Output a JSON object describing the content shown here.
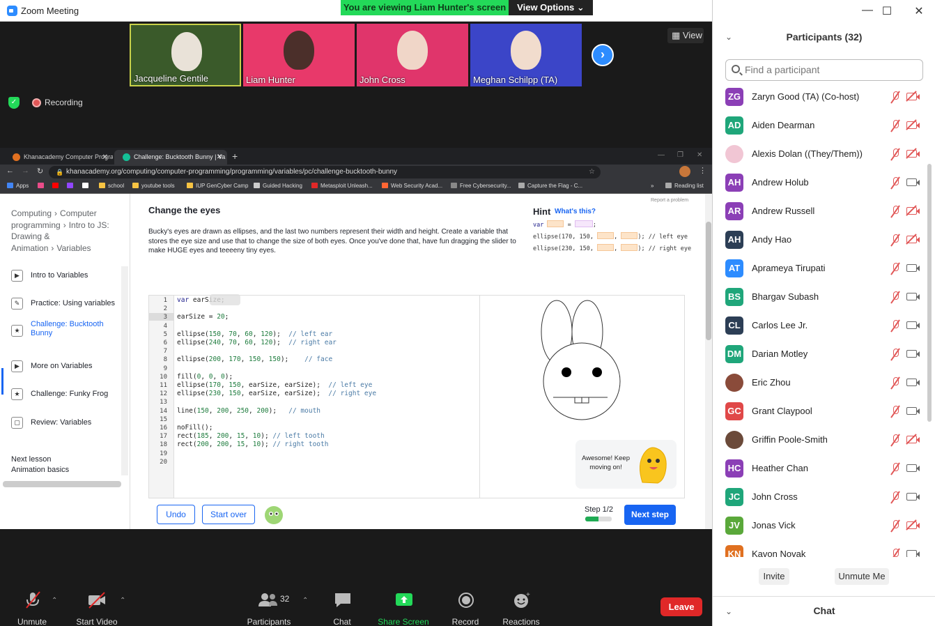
{
  "window": {
    "title": "Zoom Meeting",
    "viewing_banner": "You are viewing Liam Hunter's screen",
    "view_options": "View Options",
    "controls": {
      "min": "—",
      "max": "☐",
      "close": "✕"
    }
  },
  "videos": [
    {
      "name": "Jacqueline Gentile",
      "muted": false
    },
    {
      "name": "Liam Hunter",
      "muted": false
    },
    {
      "name": "John Cross",
      "muted": true
    },
    {
      "name": "Meghan Schilpp (TA)",
      "muted": true
    }
  ],
  "video_strip": {
    "view_label": "View",
    "recording_label": "Recording"
  },
  "browser": {
    "tabs": [
      {
        "label": "Khanacademy Computer Program",
        "active": false
      },
      {
        "label": "Challenge: Bucktooth Bunny | Va",
        "active": true
      }
    ],
    "url": "khanacademy.org/computing/computer-programming/programming/variables/pc/challenge-bucktooth-bunny",
    "bookmarks": [
      {
        "label": "Apps",
        "color": "#4285f4"
      },
      {
        "label": "",
        "color": "#ea4c89"
      },
      {
        "label": "",
        "color": "#ff0000"
      },
      {
        "label": "",
        "color": "#9146ff"
      },
      {
        "label": "",
        "color": "#ffffff"
      },
      {
        "label": "school",
        "color": "#f6c343"
      },
      {
        "label": "youtube tools",
        "color": "#f6c343"
      },
      {
        "label": "IUP GenCyber Camp",
        "color": "#f6c343"
      },
      {
        "label": "Guided Hacking",
        "color": "#cccccc"
      },
      {
        "label": "Metasploit Unleash...",
        "color": "#e02828"
      },
      {
        "label": "Web Security Acad...",
        "color": "#ff6633"
      },
      {
        "label": "Free Cybersecurity...",
        "color": "#888888"
      },
      {
        "label": "Capture the Flag - C...",
        "color": "#aaaaaa"
      },
      {
        "label": "»",
        "color": ""
      },
      {
        "label": "Reading list",
        "color": "#aaaaaa"
      }
    ]
  },
  "khan": {
    "breadcrumb": [
      {
        "text": "Computing",
        "sep": "›"
      },
      {
        "text": "Computer programming",
        "sep": "›"
      },
      {
        "text": "Intro to JS: Drawing & Animation",
        "sep": "›"
      },
      {
        "text": "Variables",
        "sep": ""
      }
    ],
    "lessons": [
      {
        "label": "Intro to Variables",
        "icon": "▶",
        "current": false
      },
      {
        "label": "Practice: Using variables",
        "icon": "✎",
        "current": false
      },
      {
        "label": "Challenge: Bucktooth Bunny",
        "icon": "★",
        "current": true
      },
      {
        "label": "More on Variables",
        "icon": "▶",
        "current": false
      },
      {
        "label": "Challenge: Funky Frog",
        "icon": "★",
        "current": false
      },
      {
        "label": "Review: Variables",
        "icon": "▢",
        "current": false
      }
    ],
    "next_lesson_label": "Next lesson",
    "next_lesson_title": "Animation basics",
    "title": "Change the eyes",
    "description": "Bucky's eyes are drawn as ellipses, and the last two numbers represent their width and height. Create a variable that stores the eye size and use that to change the size of both eyes. Once you've done that, have fun dragging the slider to make HUGE eyes and teeeeny tiny eyes.",
    "hint_title": "Hint",
    "hint_link": "What's this?",
    "report": "Report a problem",
    "hint_lines": [
      {
        "pre": "var",
        "mid": "=",
        "post": ";"
      },
      {
        "pre": "ellipse(170, 150,",
        "post": "); // left eye"
      },
      {
        "pre": "ellipse(230, 150,",
        "post": "); // right eye"
      }
    ],
    "code_lines": [
      "var earSize;",
      "",
      "earSize = 20;",
      "",
      "ellipse(150, 70, 60, 120);  // left ear",
      "ellipse(240, 70, 60, 120);  // right ear",
      "",
      "ellipse(200, 170, 150, 150);    // face",
      "",
      "fill(0, 0, 0);",
      "ellipse(170, 150, earSize, earSize);  // left eye",
      "ellipse(230, 150, earSize, earSize);  // right eye",
      "",
      "line(150, 200, 250, 200);   // mouth",
      "",
      "noFill();",
      "rect(185, 200, 15, 10); // left tooth",
      "rect(200, 200, 15, 10); // right tooth",
      "",
      ""
    ],
    "toast": "Awesome! Keep moving on!",
    "undo": "Undo",
    "start_over": "Start over",
    "step_label": "Step 1/2",
    "step_progress": 0.5,
    "next_step": "Next step"
  },
  "participants": {
    "header": "Participants (32)",
    "search_placeholder": "Find a participant",
    "list": [
      {
        "initials": "ZG",
        "name": "Zaryn Good (TA) (Co-host)",
        "color": "#8b3fb6",
        "video_off": true
      },
      {
        "initials": "AD",
        "name": "Aiden Dearman",
        "color": "#1fa67a",
        "video_off": true
      },
      {
        "initials": "",
        "name": "Alexis Dolan ((They/Them))",
        "color": "#f1c6d4",
        "video_off": true
      },
      {
        "initials": "AH",
        "name": "Andrew Holub",
        "color": "#8b3fb6",
        "video_off": false
      },
      {
        "initials": "AR",
        "name": "Andrew Russell",
        "color": "#8b3fb6",
        "video_off": true
      },
      {
        "initials": "AH",
        "name": "Andy Hao",
        "color": "#2c3e55",
        "video_off": true
      },
      {
        "initials": "AT",
        "name": "Aprameya Tirupati",
        "color": "#2d8cff",
        "video_off": false
      },
      {
        "initials": "BS",
        "name": "Bhargav Subash",
        "color": "#1fa67a",
        "video_off": false
      },
      {
        "initials": "CL",
        "name": "Carlos Lee Jr.",
        "color": "#2c3e55",
        "video_off": false
      },
      {
        "initials": "DM",
        "name": "Darian Motley",
        "color": "#1fa67a",
        "video_off": false
      },
      {
        "initials": "",
        "name": "Eric Zhou",
        "color": "#8a4b3a",
        "video_off": false
      },
      {
        "initials": "GC",
        "name": "Grant Claypool",
        "color": "#e04848",
        "video_off": false
      },
      {
        "initials": "",
        "name": "Griffin Poole-Smith",
        "color": "#6b4a3a",
        "video_off": true
      },
      {
        "initials": "HC",
        "name": "Heather Chan",
        "color": "#8b3fb6",
        "video_off": false
      },
      {
        "initials": "JC",
        "name": "John Cross",
        "color": "#1fa67a",
        "video_off": false
      },
      {
        "initials": "JV",
        "name": "Jonas Vick",
        "color": "#5aa83a",
        "video_off": true
      },
      {
        "initials": "KN",
        "name": "Kavon Novak",
        "color": "#e07020",
        "video_off": false
      }
    ],
    "invite": "Invite",
    "unmute_me": "Unmute Me",
    "chat_header": "Chat"
  },
  "toolbar": {
    "unmute": "Unmute",
    "start_video": "Start Video",
    "participants": "Participants",
    "participants_count": "32",
    "chat": "Chat",
    "share_screen": "Share Screen",
    "record": "Record",
    "reactions": "Reactions",
    "leave": "Leave"
  }
}
